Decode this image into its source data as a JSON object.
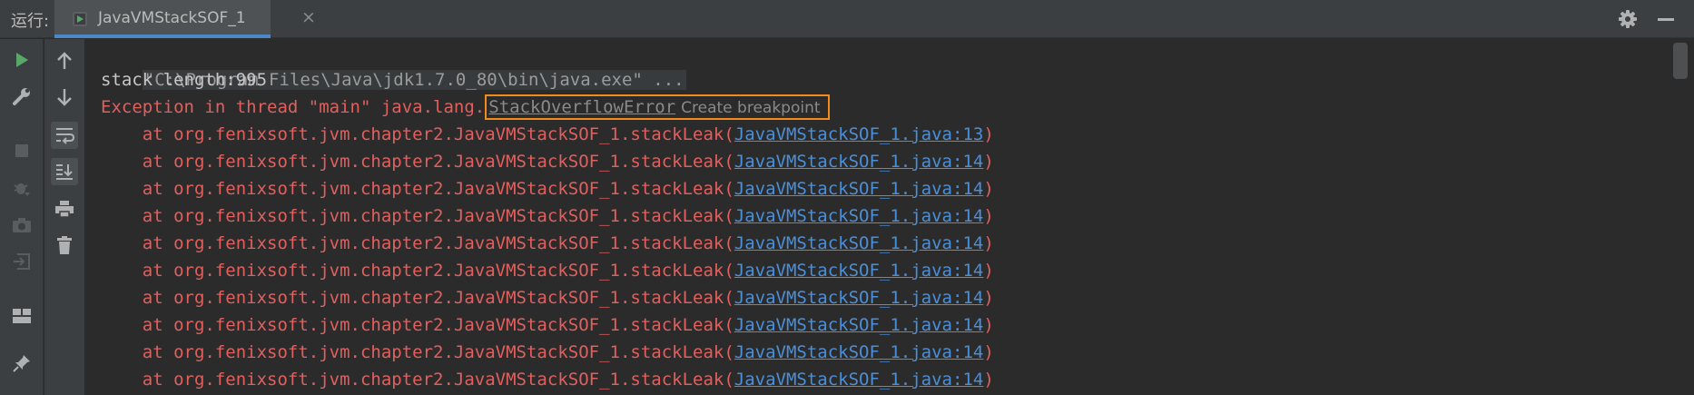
{
  "header": {
    "run_label": "运行:",
    "tab_label": "JavaVMStackSOF_1",
    "close_glyph": "×"
  },
  "console": {
    "command": "\"C:\\Program Files\\Java\\jdk1.7.0_80\\bin\\java.exe\" ...",
    "stack_length": "stack length:995",
    "exception_prefix": "Exception in thread \"main\" java.lang.",
    "exception_class": "StackOverflowError",
    "create_breakpoint": "Create breakpoint",
    "frames": [
      {
        "prefix": "    at org.fenixsoft.jvm.chapter2.JavaVMStackSOF_1.stackLeak(",
        "link": "JavaVMStackSOF_1.java:13",
        "suffix": ")"
      },
      {
        "prefix": "    at org.fenixsoft.jvm.chapter2.JavaVMStackSOF_1.stackLeak(",
        "link": "JavaVMStackSOF_1.java:14",
        "suffix": ")"
      },
      {
        "prefix": "    at org.fenixsoft.jvm.chapter2.JavaVMStackSOF_1.stackLeak(",
        "link": "JavaVMStackSOF_1.java:14",
        "suffix": ")"
      },
      {
        "prefix": "    at org.fenixsoft.jvm.chapter2.JavaVMStackSOF_1.stackLeak(",
        "link": "JavaVMStackSOF_1.java:14",
        "suffix": ")"
      },
      {
        "prefix": "    at org.fenixsoft.jvm.chapter2.JavaVMStackSOF_1.stackLeak(",
        "link": "JavaVMStackSOF_1.java:14",
        "suffix": ")"
      },
      {
        "prefix": "    at org.fenixsoft.jvm.chapter2.JavaVMStackSOF_1.stackLeak(",
        "link": "JavaVMStackSOF_1.java:14",
        "suffix": ")"
      },
      {
        "prefix": "    at org.fenixsoft.jvm.chapter2.JavaVMStackSOF_1.stackLeak(",
        "link": "JavaVMStackSOF_1.java:14",
        "suffix": ")"
      },
      {
        "prefix": "    at org.fenixsoft.jvm.chapter2.JavaVMStackSOF_1.stackLeak(",
        "link": "JavaVMStackSOF_1.java:14",
        "suffix": ")"
      },
      {
        "prefix": "    at org.fenixsoft.jvm.chapter2.JavaVMStackSOF_1.stackLeak(",
        "link": "JavaVMStackSOF_1.java:14",
        "suffix": ")"
      },
      {
        "prefix": "    at org.fenixsoft.jvm.chapter2.JavaVMStackSOF_1.stackLeak(",
        "link": "JavaVMStackSOF_1.java:14",
        "suffix": ")"
      }
    ]
  },
  "icons": {
    "run": "play-icon",
    "settings": "wrench-icon",
    "stop": "stop-icon",
    "debug": "bug-icon",
    "snapshot": "camera-icon",
    "login": "login-icon",
    "layout": "layout-icon",
    "pin": "pin-icon",
    "up": "arrow-up-icon",
    "down": "arrow-down-icon",
    "wrap": "soft-wrap-icon",
    "scroll_end": "scroll-to-end-icon",
    "print": "print-icon",
    "trash": "trash-icon",
    "gear": "gear-icon",
    "minimize": "minimize-icon"
  },
  "colors": {
    "error_text": "#e0605e",
    "link": "#4b8fd8",
    "highlight_border": "#f28a1c",
    "run_green": "#59a869"
  }
}
